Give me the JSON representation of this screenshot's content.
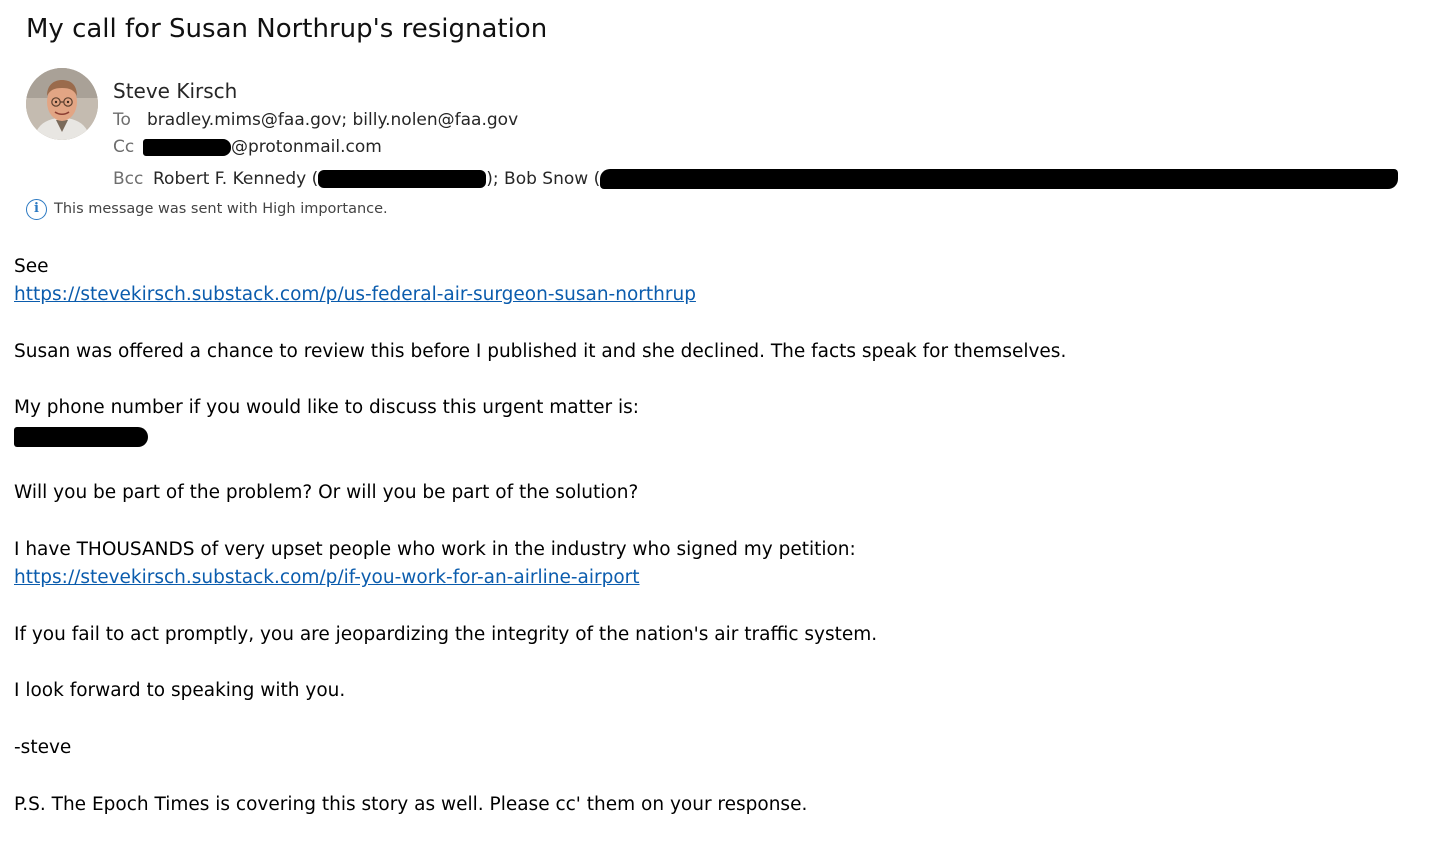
{
  "email": {
    "subject": "My call for Susan Northrup's resignation",
    "sender": "Steve Kirsch",
    "to_label": "To",
    "to_value": "bradley.mims@faa.gov; billy.nolen@faa.gov",
    "cc_label": "Cc",
    "cc_value_suffix": "@protonmail.com",
    "bcc_label": "Bcc",
    "bcc_name_1": "Robert F. Kennedy (",
    "bcc_mid": "); Bob Snow (",
    "importance_text": "This message was sent with High importance."
  },
  "body": {
    "line_see": "See",
    "link_1": "https://stevekirsch.substack.com/p/us-federal-air-surgeon-susan-northrup",
    "line_review": "Susan was offered a chance to review this before I published it and she declined. The facts speak for themselves.",
    "line_phone": "My phone number if you would like to discuss this urgent matter is:",
    "line_question": "Will you be part of the problem? Or will you be part of the solution?",
    "line_thousands": "I have THOUSANDS of very upset people who work in the industry who signed my petition:",
    "link_2": "https://stevekirsch.substack.com/p/if-you-work-for-an-airline-airport",
    "line_fail": "If you fail to act promptly, you are jeopardizing the integrity of  the nation's air traffic system.",
    "line_forward": "I look forward to speaking with you.",
    "line_sign": "-steve",
    "line_ps": "P.S. The Epoch Times is covering this story as well. Please cc' them on your response."
  },
  "icons": {
    "info": "info-icon",
    "avatar": "sender-avatar"
  },
  "colors": {
    "link": "#0b5cad",
    "info_icon": "#2b79c2",
    "redaction": "#000000"
  }
}
